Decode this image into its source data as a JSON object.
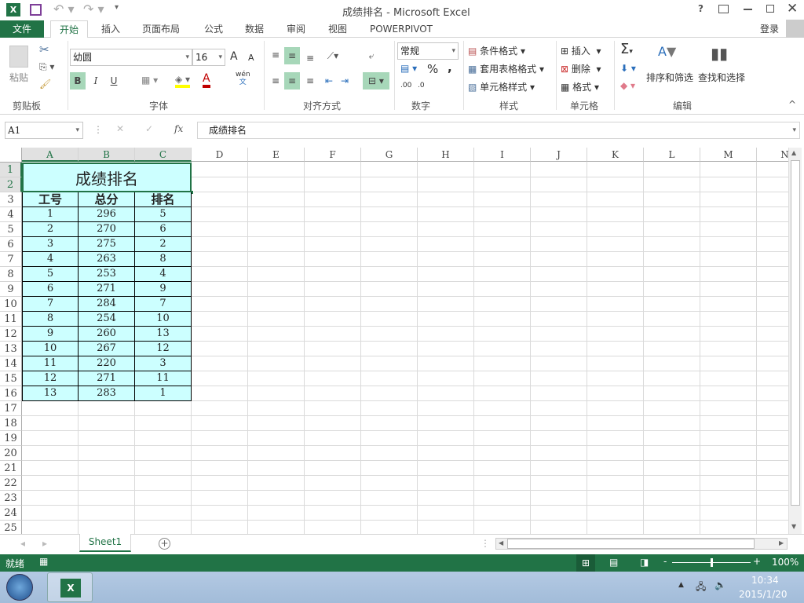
{
  "window": {
    "title": "成绩排名 - Microsoft Excel",
    "help": "?",
    "signin": "登录"
  },
  "tabs": [
    "文件",
    "开始",
    "插入",
    "页面布局",
    "公式",
    "数据",
    "审阅",
    "视图",
    "POWERPIVOT"
  ],
  "active_tab": "开始",
  "ribbon": {
    "clipboard": {
      "label": "剪贴板",
      "paste": "粘贴"
    },
    "font": {
      "label": "字体",
      "name": "幼圆",
      "size": "16",
      "bold": "B",
      "italic": "I",
      "underline": "U",
      "phonetic_top": "wén",
      "phonetic_bottom": "文",
      "grow": "A",
      "shrink": "A",
      "color_a": "A"
    },
    "alignment": {
      "label": "对齐方式"
    },
    "number": {
      "label": "数字",
      "format": "常规",
      "percent": "%",
      "comma": ",",
      "inc_decimal": ".00",
      "dec_decimal": ".0"
    },
    "styles": {
      "label": "样式",
      "conditional": "条件格式",
      "table": "套用表格格式",
      "cell_styles": "单元格样式"
    },
    "cells": {
      "label": "单元格",
      "insert": "插入",
      "delete": "删除",
      "format": "格式"
    },
    "editing": {
      "label": "编辑",
      "sum": "Σ",
      "sort": "排序和筛选",
      "find": "查找和选择"
    }
  },
  "formula_bar": {
    "name_box": "A1",
    "fx": "fx",
    "content": "成绩排名"
  },
  "columns": [
    "A",
    "B",
    "C",
    "D",
    "E",
    "F",
    "G",
    "H",
    "I",
    "J",
    "K",
    "L",
    "M",
    "N"
  ],
  "rows": [
    "1",
    "2",
    "3",
    "4",
    "5",
    "6",
    "7",
    "8",
    "9",
    "10",
    "11",
    "12",
    "13",
    "14",
    "15",
    "16",
    "17",
    "18",
    "19",
    "20",
    "21",
    "22",
    "23",
    "24",
    "25"
  ],
  "sheet": {
    "title": "成绩排名",
    "headers": [
      "工号",
      "总分",
      "排名"
    ],
    "data": [
      [
        "1",
        "296",
        "5"
      ],
      [
        "2",
        "270",
        "6"
      ],
      [
        "3",
        "275",
        "2"
      ],
      [
        "4",
        "263",
        "8"
      ],
      [
        "5",
        "253",
        "4"
      ],
      [
        "6",
        "271",
        "9"
      ],
      [
        "7",
        "284",
        "7"
      ],
      [
        "8",
        "254",
        "10"
      ],
      [
        "9",
        "260",
        "13"
      ],
      [
        "10",
        "267",
        "12"
      ],
      [
        "11",
        "220",
        "3"
      ],
      [
        "12",
        "271",
        "11"
      ],
      [
        "13",
        "283",
        "1"
      ]
    ],
    "fill_color": "#ccffff"
  },
  "sheet_tabs": [
    "Sheet1"
  ],
  "status": {
    "ready": "就绪",
    "zoom": "100%",
    "zoom_level": 100
  },
  "taskbar": {
    "time": "10:34",
    "date": "2015/1/20"
  },
  "colors": {
    "accent": "#217346"
  }
}
